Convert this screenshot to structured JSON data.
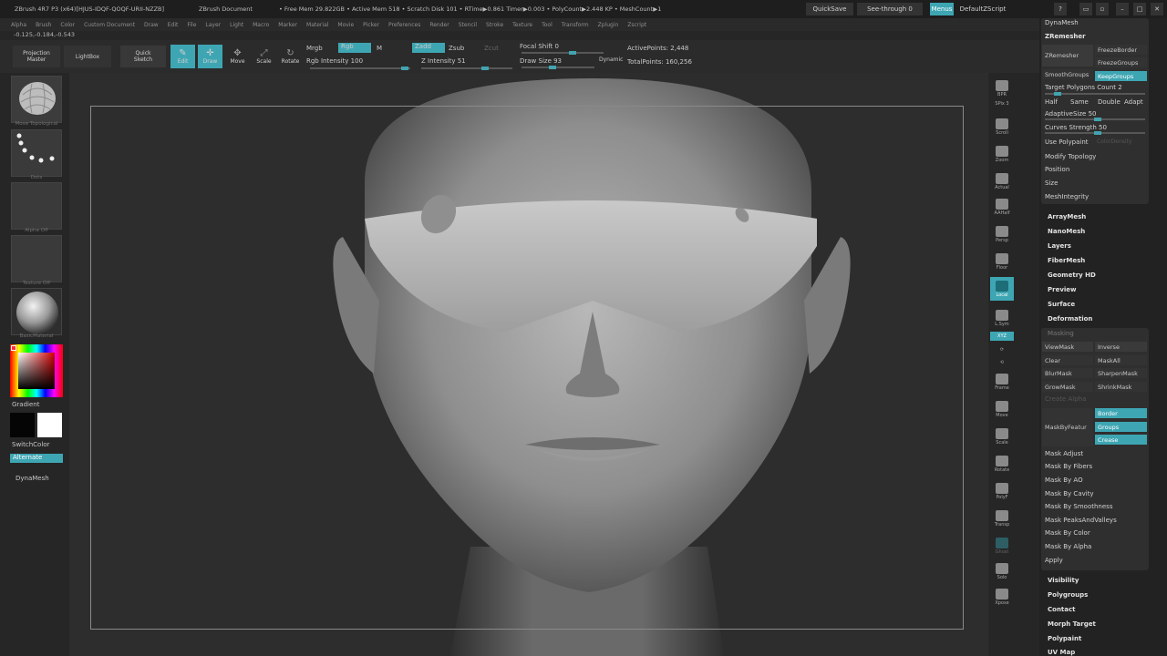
{
  "title_bar": {
    "left": "ZBrush 4R7 P3 (x64)[HJUS-IDQF-QOQF-URII-NZZB]",
    "document": "ZBrush Document",
    "stats": "• Free Mem 29.822GB • Active Mem 518 • Scratch Disk 101 • RTime▶0.861 Timer▶0.003 • PolyCount▶2.448 KP • MeshCount▶1",
    "quicksave": "QuickSave",
    "seethrough": "See-through  0",
    "menus": "Menus",
    "script": "DefaultZScript"
  },
  "menubar": [
    "Alpha",
    "Brush",
    "Color",
    "Custom Document",
    "Draw",
    "Edit",
    "File",
    "Layer",
    "Light",
    "Macro",
    "Marker",
    "Material",
    "Movie",
    "Picker",
    "Preferences",
    "Render",
    "Stencil",
    "Stroke",
    "Texture",
    "Tool",
    "Transform",
    "Zplugin",
    "Zscript"
  ],
  "coords": "-0.125,-0.184,-0.543",
  "shelf": {
    "projection_master": "Projection Master",
    "lightbox": "LightBox",
    "quick_sketch": "Quick Sketch",
    "edit": "Edit",
    "draw": "Draw",
    "move": "Move",
    "scale": "Scale",
    "rotate": "Rotate",
    "mrgb": "Mrgb",
    "rgb": "Rgb",
    "m": "M",
    "zadd": "Zadd",
    "zsub": "Zsub",
    "zcut": "Zcut",
    "rgb_intensity": "Rgb Intensity 100",
    "z_intensity": "Z Intensity 51",
    "focal_shift": "Focal Shift 0",
    "draw_size": "Draw Size 93",
    "dynamic": "Dynamic",
    "active_points": "ActivePoints: 2,448",
    "total_points": "TotalPoints: 160,256"
  },
  "left_panel": {
    "brush_label": "Move Topological",
    "stroke_label": "Dots",
    "alpha_label": "Alpha Off",
    "texture_label": "Texture Off",
    "material_label": "BasicMaterial",
    "gradient": "Gradient",
    "switchcolor": "SwitchColor",
    "alternate": "Alternate",
    "dynamesh": "DynaMesh"
  },
  "right_bar": [
    "BPR",
    "SPix 3",
    "Scroll",
    "Zoom",
    "Actual",
    "AAHalf",
    "Persp",
    "Floor",
    "Local",
    "L.Sym",
    "XYZ",
    "",
    "",
    "Frame",
    "Move",
    "Scale",
    "Rotate",
    "PolyF",
    "Transp",
    "Ghost",
    "Solo",
    "Xpose"
  ],
  "tray": {
    "dynamesh": "DynaMesh",
    "zremesher": "ZRemesher",
    "zremesher_btn": "ZRemesher",
    "freeze_border": "FreezeBorder",
    "freeze_groups": "FreezeGroups",
    "smooth_groups": "SmoothGroups",
    "keep_groups": "KeepGroups",
    "target_polys": "Target Polygons Count 2",
    "half": "Half",
    "same": "Same",
    "double": "Double",
    "adapt": "Adapt",
    "adaptive_size": "AdaptiveSize 50",
    "curves_strength": "Curves Strength 50",
    "use_polypaint": "Use Polypaint",
    "color_density": "ColorDensity",
    "modify_topology": "Modify Topology",
    "position": "Position",
    "size": "Size",
    "mesh_integrity": "MeshIntegrity",
    "array_mesh": "ArrayMesh",
    "nano_mesh": "NanoMesh",
    "layers": "Layers",
    "fiber_mesh": "FiberMesh",
    "geometry_hd": "Geometry HD",
    "preview": "Preview",
    "surface": "Surface",
    "deformation": "Deformation",
    "masking": "Masking",
    "view_mask": "ViewMask",
    "inverse": "Inverse",
    "clear": "Clear",
    "mask_all": "MaskAll",
    "blur_mask": "BlurMask",
    "sharpen_mask": "SharpenMask",
    "grow_mask": "GrowMask",
    "shrink_mask": "ShrinkMask",
    "create_alpha": "Create Alpha",
    "mask_by_feature": "MaskByFeatur",
    "border": "Border",
    "groups": "Groups",
    "crease": "Crease",
    "mask_adjust": "Mask Adjust",
    "mask_by_fibers": "Mask By Fibers",
    "mask_by_ao": "Mask By AO",
    "mask_by_cavity": "Mask By Cavity",
    "mask_by_smoothness": "Mask By Smoothness",
    "mask_peaks": "Mask PeaksAndValleys",
    "mask_by_color": "Mask By Color",
    "mask_by_alpha": "Mask By Alpha",
    "apply": "Apply",
    "visibility": "Visibility",
    "polygroups": "Polygroups",
    "contact": "Contact",
    "morph_target": "Morph Target",
    "polypaint": "Polypaint",
    "uv_map": "UV Map"
  },
  "colors": {
    "accent": "#3ea6b3",
    "panel": "#2b2b2b",
    "canvas": "#2d2d2d"
  }
}
